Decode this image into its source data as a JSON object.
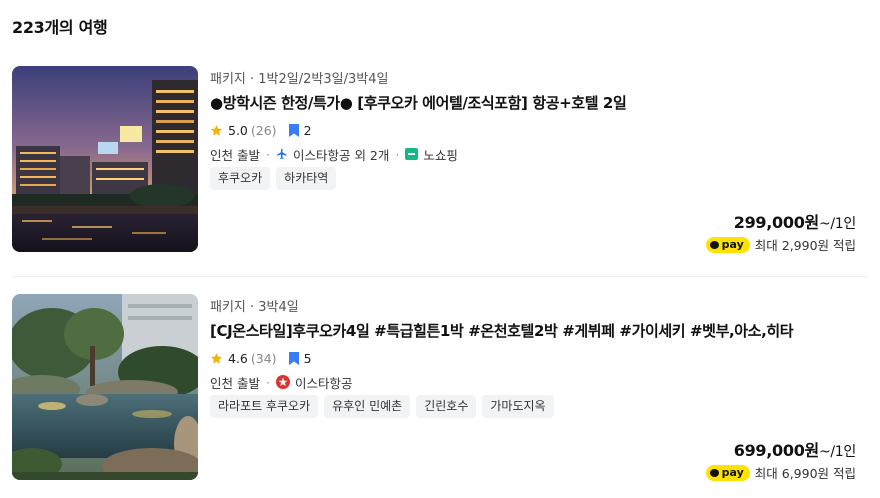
{
  "result_count_title": "223개의 여행",
  "colors": {
    "pay_badge": "#ffe300",
    "star": "#f5b301",
    "bookmark": "#3a7bf6",
    "noshop": "#12b886",
    "airline_red": "#e03131"
  },
  "items": [
    {
      "meta": "패키지 · 1박2일/2박3일/3박4일",
      "title": "●방학시즌 한정/특가●  [후쿠오카 에어텔/조식포함] 항공+호텔 2일",
      "rating": "5.0",
      "rating_count": "(26)",
      "bookmarks": "2",
      "departure": "인천 출발",
      "airline": "이스타항공 외 2개",
      "airline_icon": "plane-icon",
      "no_shopping": "노쇼핑",
      "tags": [
        "후쿠오카",
        "하카타역"
      ],
      "price": "299,000원",
      "price_unit": "~/1인",
      "pay_label": "pay",
      "points": "최대 2,990원 적립",
      "image": "night-city-river"
    },
    {
      "meta": "패키지 · 3박4일",
      "title": "[CJ온스타일]후쿠오카4일 #특급힐튼1박 #온천호텔2박 #게뷔페 #가이세키 #벳부,아소,히타",
      "rating": "4.6",
      "rating_count": "(34)",
      "bookmarks": "5",
      "departure": "인천 출발",
      "airline": "이스타항공",
      "airline_icon": "airline-logo-icon",
      "tags": [
        "라라포트 후쿠오카",
        "유후인 민예촌",
        "긴린호수",
        "가마도지옥"
      ],
      "price": "699,000원",
      "price_unit": "~/1인",
      "pay_label": "pay",
      "points": "최대 6,990원 적립",
      "image": "garden-pond"
    }
  ]
}
